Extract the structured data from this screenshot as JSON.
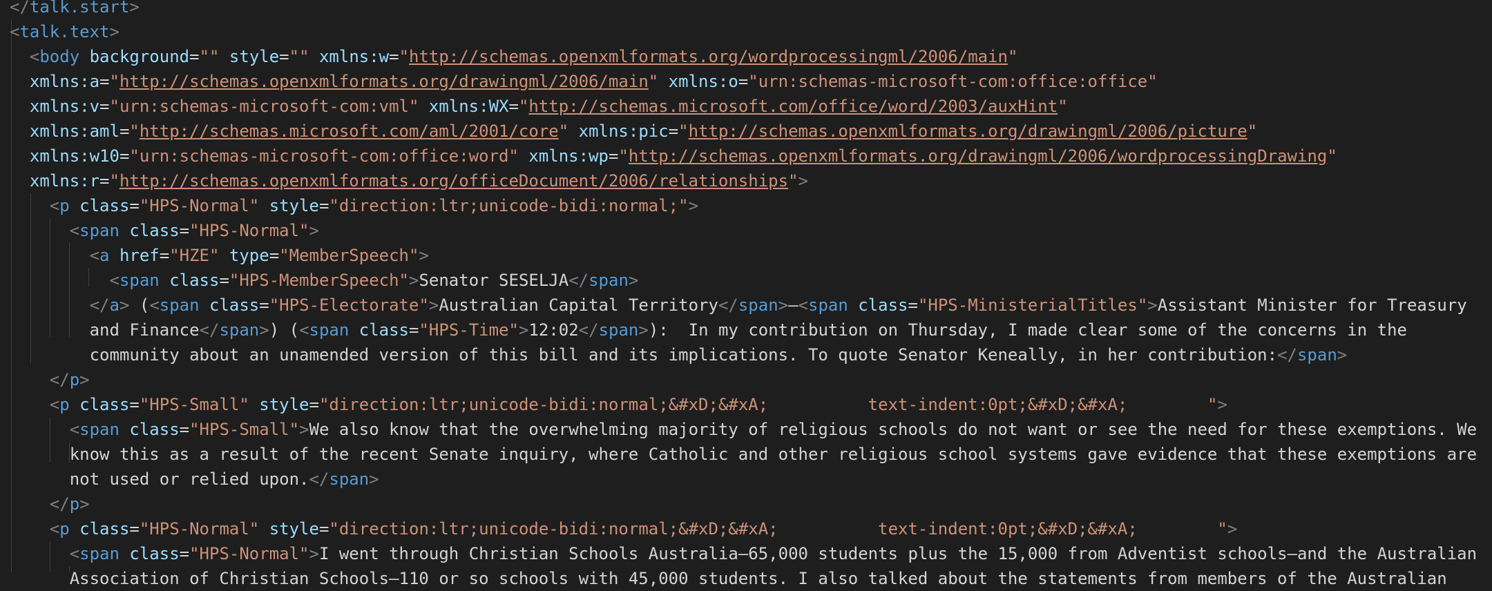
{
  "colors": {
    "background": "#1e1e1e",
    "tag": "#569cd6",
    "bracket": "#808080",
    "attribute": "#9cdcfe",
    "string": "#ce9178",
    "text": "#d4d4d4",
    "indent_guide": "#404040"
  },
  "lines": [
    [
      {
        "t": "</",
        "c": "punc"
      },
      {
        "t": "talk.start",
        "c": "tag"
      },
      {
        "t": ">",
        "c": "punc"
      }
    ],
    [
      {
        "t": "<",
        "c": "punc"
      },
      {
        "t": "talk.text",
        "c": "tag"
      },
      {
        "t": ">",
        "c": "punc"
      }
    ],
    [
      {
        "t": "  <",
        "c": "punc"
      },
      {
        "t": "body",
        "c": "tag"
      },
      {
        "t": " background",
        "c": "attr"
      },
      {
        "t": "=",
        "c": "txt"
      },
      {
        "t": "\"\"",
        "c": "str"
      },
      {
        "t": " style",
        "c": "attr"
      },
      {
        "t": "=",
        "c": "txt"
      },
      {
        "t": "\"\"",
        "c": "str"
      },
      {
        "t": " xmlns:w",
        "c": "attr"
      },
      {
        "t": "=",
        "c": "txt"
      },
      {
        "t": "\"",
        "c": "str"
      },
      {
        "t": "http://schemas.openxmlformats.org/wordprocessingml/2006/main",
        "c": "url"
      },
      {
        "t": "\"",
        "c": "str"
      }
    ],
    [
      {
        "t": "  xmlns:a",
        "c": "attr"
      },
      {
        "t": "=",
        "c": "txt"
      },
      {
        "t": "\"",
        "c": "str"
      },
      {
        "t": "http://schemas.openxmlformats.org/drawingml/2006/main",
        "c": "url"
      },
      {
        "t": "\"",
        "c": "str"
      },
      {
        "t": " xmlns:o",
        "c": "attr"
      },
      {
        "t": "=",
        "c": "txt"
      },
      {
        "t": "\"urn:schemas-microsoft-com:office:office\"",
        "c": "str"
      }
    ],
    [
      {
        "t": "  xmlns:v",
        "c": "attr"
      },
      {
        "t": "=",
        "c": "txt"
      },
      {
        "t": "\"urn:schemas-microsoft-com:vml\"",
        "c": "str"
      },
      {
        "t": " xmlns:WX",
        "c": "attr"
      },
      {
        "t": "=",
        "c": "txt"
      },
      {
        "t": "\"",
        "c": "str"
      },
      {
        "t": "http://schemas.microsoft.com/office/word/2003/auxHint",
        "c": "url"
      },
      {
        "t": "\"",
        "c": "str"
      }
    ],
    [
      {
        "t": "  xmlns:aml",
        "c": "attr"
      },
      {
        "t": "=",
        "c": "txt"
      },
      {
        "t": "\"",
        "c": "str"
      },
      {
        "t": "http://schemas.microsoft.com/aml/2001/core",
        "c": "url"
      },
      {
        "t": "\"",
        "c": "str"
      },
      {
        "t": " xmlns:pic",
        "c": "attr"
      },
      {
        "t": "=",
        "c": "txt"
      },
      {
        "t": "\"",
        "c": "str"
      },
      {
        "t": "http://schemas.openxmlformats.org/drawingml/2006/picture",
        "c": "url"
      },
      {
        "t": "\"",
        "c": "str"
      }
    ],
    [
      {
        "t": "  xmlns:w10",
        "c": "attr"
      },
      {
        "t": "=",
        "c": "txt"
      },
      {
        "t": "\"urn:schemas-microsoft-com:office:word\"",
        "c": "str"
      },
      {
        "t": " xmlns:wp",
        "c": "attr"
      },
      {
        "t": "=",
        "c": "txt"
      },
      {
        "t": "\"",
        "c": "str"
      },
      {
        "t": "http://schemas.openxmlformats.org/drawingml/2006/wordprocessingDrawing",
        "c": "url"
      },
      {
        "t": "\"",
        "c": "str"
      }
    ],
    [
      {
        "t": "  xmlns:r",
        "c": "attr"
      },
      {
        "t": "=",
        "c": "txt"
      },
      {
        "t": "\"",
        "c": "str"
      },
      {
        "t": "http://schemas.openxmlformats.org/officeDocument/2006/relationships",
        "c": "url"
      },
      {
        "t": "\"",
        "c": "str"
      },
      {
        "t": ">",
        "c": "punc"
      }
    ],
    [
      {
        "t": "    <",
        "c": "punc"
      },
      {
        "t": "p",
        "c": "tag"
      },
      {
        "t": " class",
        "c": "attr"
      },
      {
        "t": "=",
        "c": "txt"
      },
      {
        "t": "\"HPS-Normal\"",
        "c": "str"
      },
      {
        "t": " style",
        "c": "attr"
      },
      {
        "t": "=",
        "c": "txt"
      },
      {
        "t": "\"direction:ltr;unicode-bidi:normal;\"",
        "c": "str"
      },
      {
        "t": ">",
        "c": "punc"
      }
    ],
    [
      {
        "t": "      <",
        "c": "punc"
      },
      {
        "t": "span",
        "c": "tag"
      },
      {
        "t": " class",
        "c": "attr"
      },
      {
        "t": "=",
        "c": "txt"
      },
      {
        "t": "\"HPS-Normal\"",
        "c": "str"
      },
      {
        "t": ">",
        "c": "punc"
      }
    ],
    [
      {
        "t": "        <",
        "c": "punc"
      },
      {
        "t": "a",
        "c": "tag"
      },
      {
        "t": " href",
        "c": "attr"
      },
      {
        "t": "=",
        "c": "txt"
      },
      {
        "t": "\"HZE\"",
        "c": "str"
      },
      {
        "t": " type",
        "c": "attr"
      },
      {
        "t": "=",
        "c": "txt"
      },
      {
        "t": "\"MemberSpeech\"",
        "c": "str"
      },
      {
        "t": ">",
        "c": "punc"
      }
    ],
    [
      {
        "t": "          <",
        "c": "punc"
      },
      {
        "t": "span",
        "c": "tag"
      },
      {
        "t": " class",
        "c": "attr"
      },
      {
        "t": "=",
        "c": "txt"
      },
      {
        "t": "\"HPS-MemberSpeech\"",
        "c": "str"
      },
      {
        "t": ">",
        "c": "punc"
      },
      {
        "t": "Senator SESELJA",
        "c": "txt"
      },
      {
        "t": "</",
        "c": "punc"
      },
      {
        "t": "span",
        "c": "tag"
      },
      {
        "t": ">",
        "c": "punc"
      }
    ],
    [
      {
        "t": "        </",
        "c": "punc"
      },
      {
        "t": "a",
        "c": "tag"
      },
      {
        "t": ">",
        "c": "punc"
      },
      {
        "t": " (",
        "c": "txt"
      },
      {
        "t": "<",
        "c": "punc"
      },
      {
        "t": "span",
        "c": "tag"
      },
      {
        "t": " class",
        "c": "attr"
      },
      {
        "t": "=",
        "c": "txt"
      },
      {
        "t": "\"HPS-Electorate\"",
        "c": "str"
      },
      {
        "t": ">",
        "c": "punc"
      },
      {
        "t": "Australian Capital Territory",
        "c": "txt"
      },
      {
        "t": "</",
        "c": "punc"
      },
      {
        "t": "span",
        "c": "tag"
      },
      {
        "t": ">",
        "c": "punc"
      },
      {
        "t": "—",
        "c": "txt"
      },
      {
        "t": "<",
        "c": "punc"
      },
      {
        "t": "span",
        "c": "tag"
      },
      {
        "t": " class",
        "c": "attr"
      },
      {
        "t": "=",
        "c": "txt"
      },
      {
        "t": "\"HPS-MinisterialTitles\"",
        "c": "str"
      },
      {
        "t": ">",
        "c": "punc"
      },
      {
        "t": "Assistant Minister for Treasury",
        "c": "txt"
      }
    ],
    [
      {
        "t": "        and Finance",
        "c": "txt"
      },
      {
        "t": "</",
        "c": "punc"
      },
      {
        "t": "span",
        "c": "tag"
      },
      {
        "t": ">",
        "c": "punc"
      },
      {
        "t": ") (",
        "c": "txt"
      },
      {
        "t": "<",
        "c": "punc"
      },
      {
        "t": "span",
        "c": "tag"
      },
      {
        "t": " class",
        "c": "attr"
      },
      {
        "t": "=",
        "c": "txt"
      },
      {
        "t": "\"HPS-Time\"",
        "c": "str"
      },
      {
        "t": ">",
        "c": "punc"
      },
      {
        "t": "12:02",
        "c": "txt"
      },
      {
        "t": "</",
        "c": "punc"
      },
      {
        "t": "span",
        "c": "tag"
      },
      {
        "t": ">",
        "c": "punc"
      },
      {
        "t": "):  In my contribution on Thursday, I made clear some of the concerns in the",
        "c": "txt"
      }
    ],
    [
      {
        "t": "        community about an unamended version of this bill and its implications. To quote Senator Keneally, in her contribution:",
        "c": "txt"
      },
      {
        "t": "</",
        "c": "punc"
      },
      {
        "t": "span",
        "c": "tag"
      },
      {
        "t": ">",
        "c": "punc"
      }
    ],
    [
      {
        "t": "    </",
        "c": "punc"
      },
      {
        "t": "p",
        "c": "tag"
      },
      {
        "t": ">",
        "c": "punc"
      }
    ],
    [
      {
        "t": "    <",
        "c": "punc"
      },
      {
        "t": "p",
        "c": "tag"
      },
      {
        "t": " class",
        "c": "attr"
      },
      {
        "t": "=",
        "c": "txt"
      },
      {
        "t": "\"HPS-Small\"",
        "c": "str"
      },
      {
        "t": " style",
        "c": "attr"
      },
      {
        "t": "=",
        "c": "txt"
      },
      {
        "t": "\"direction:ltr;unicode-bidi:normal;&#xD;&#xA;          text-indent:0pt;&#xD;&#xA;        \"",
        "c": "str"
      },
      {
        "t": ">",
        "c": "punc"
      }
    ],
    [
      {
        "t": "      <",
        "c": "punc"
      },
      {
        "t": "span",
        "c": "tag"
      },
      {
        "t": " class",
        "c": "attr"
      },
      {
        "t": "=",
        "c": "txt"
      },
      {
        "t": "\"HPS-Small\"",
        "c": "str"
      },
      {
        "t": ">",
        "c": "punc"
      },
      {
        "t": "We also know that the overwhelming majority of religious schools do not want or see the need for these exemptions. We",
        "c": "txt"
      }
    ],
    [
      {
        "t": "      know this as a result of the recent Senate inquiry, where Catholic and other religious school systems gave evidence that these exemptions are",
        "c": "txt"
      }
    ],
    [
      {
        "t": "      not used or relied upon.",
        "c": "txt"
      },
      {
        "t": "</",
        "c": "punc"
      },
      {
        "t": "span",
        "c": "tag"
      },
      {
        "t": ">",
        "c": "punc"
      }
    ],
    [
      {
        "t": "    </",
        "c": "punc"
      },
      {
        "t": "p",
        "c": "tag"
      },
      {
        "t": ">",
        "c": "punc"
      }
    ],
    [
      {
        "t": "    <",
        "c": "punc"
      },
      {
        "t": "p",
        "c": "tag"
      },
      {
        "t": " class",
        "c": "attr"
      },
      {
        "t": "=",
        "c": "txt"
      },
      {
        "t": "\"HPS-Normal\"",
        "c": "str"
      },
      {
        "t": " style",
        "c": "attr"
      },
      {
        "t": "=",
        "c": "txt"
      },
      {
        "t": "\"direction:ltr;unicode-bidi:normal;&#xD;&#xA;          text-indent:0pt;&#xD;&#xA;        \"",
        "c": "str"
      },
      {
        "t": ">",
        "c": "punc"
      }
    ],
    [
      {
        "t": "      <",
        "c": "punc"
      },
      {
        "t": "span",
        "c": "tag"
      },
      {
        "t": " class",
        "c": "attr"
      },
      {
        "t": "=",
        "c": "txt"
      },
      {
        "t": "\"HPS-Normal\"",
        "c": "str"
      },
      {
        "t": ">",
        "c": "punc"
      },
      {
        "t": "I went through Christian Schools Australia—65,000 students plus the 15,000 from Adventist schools—and the Australian",
        "c": "txt"
      }
    ],
    [
      {
        "t": "      Association of Christian Schools—110 or so schools with 45,000 students. I also talked about the statements from members of the Australian",
        "c": "txt"
      }
    ]
  ]
}
